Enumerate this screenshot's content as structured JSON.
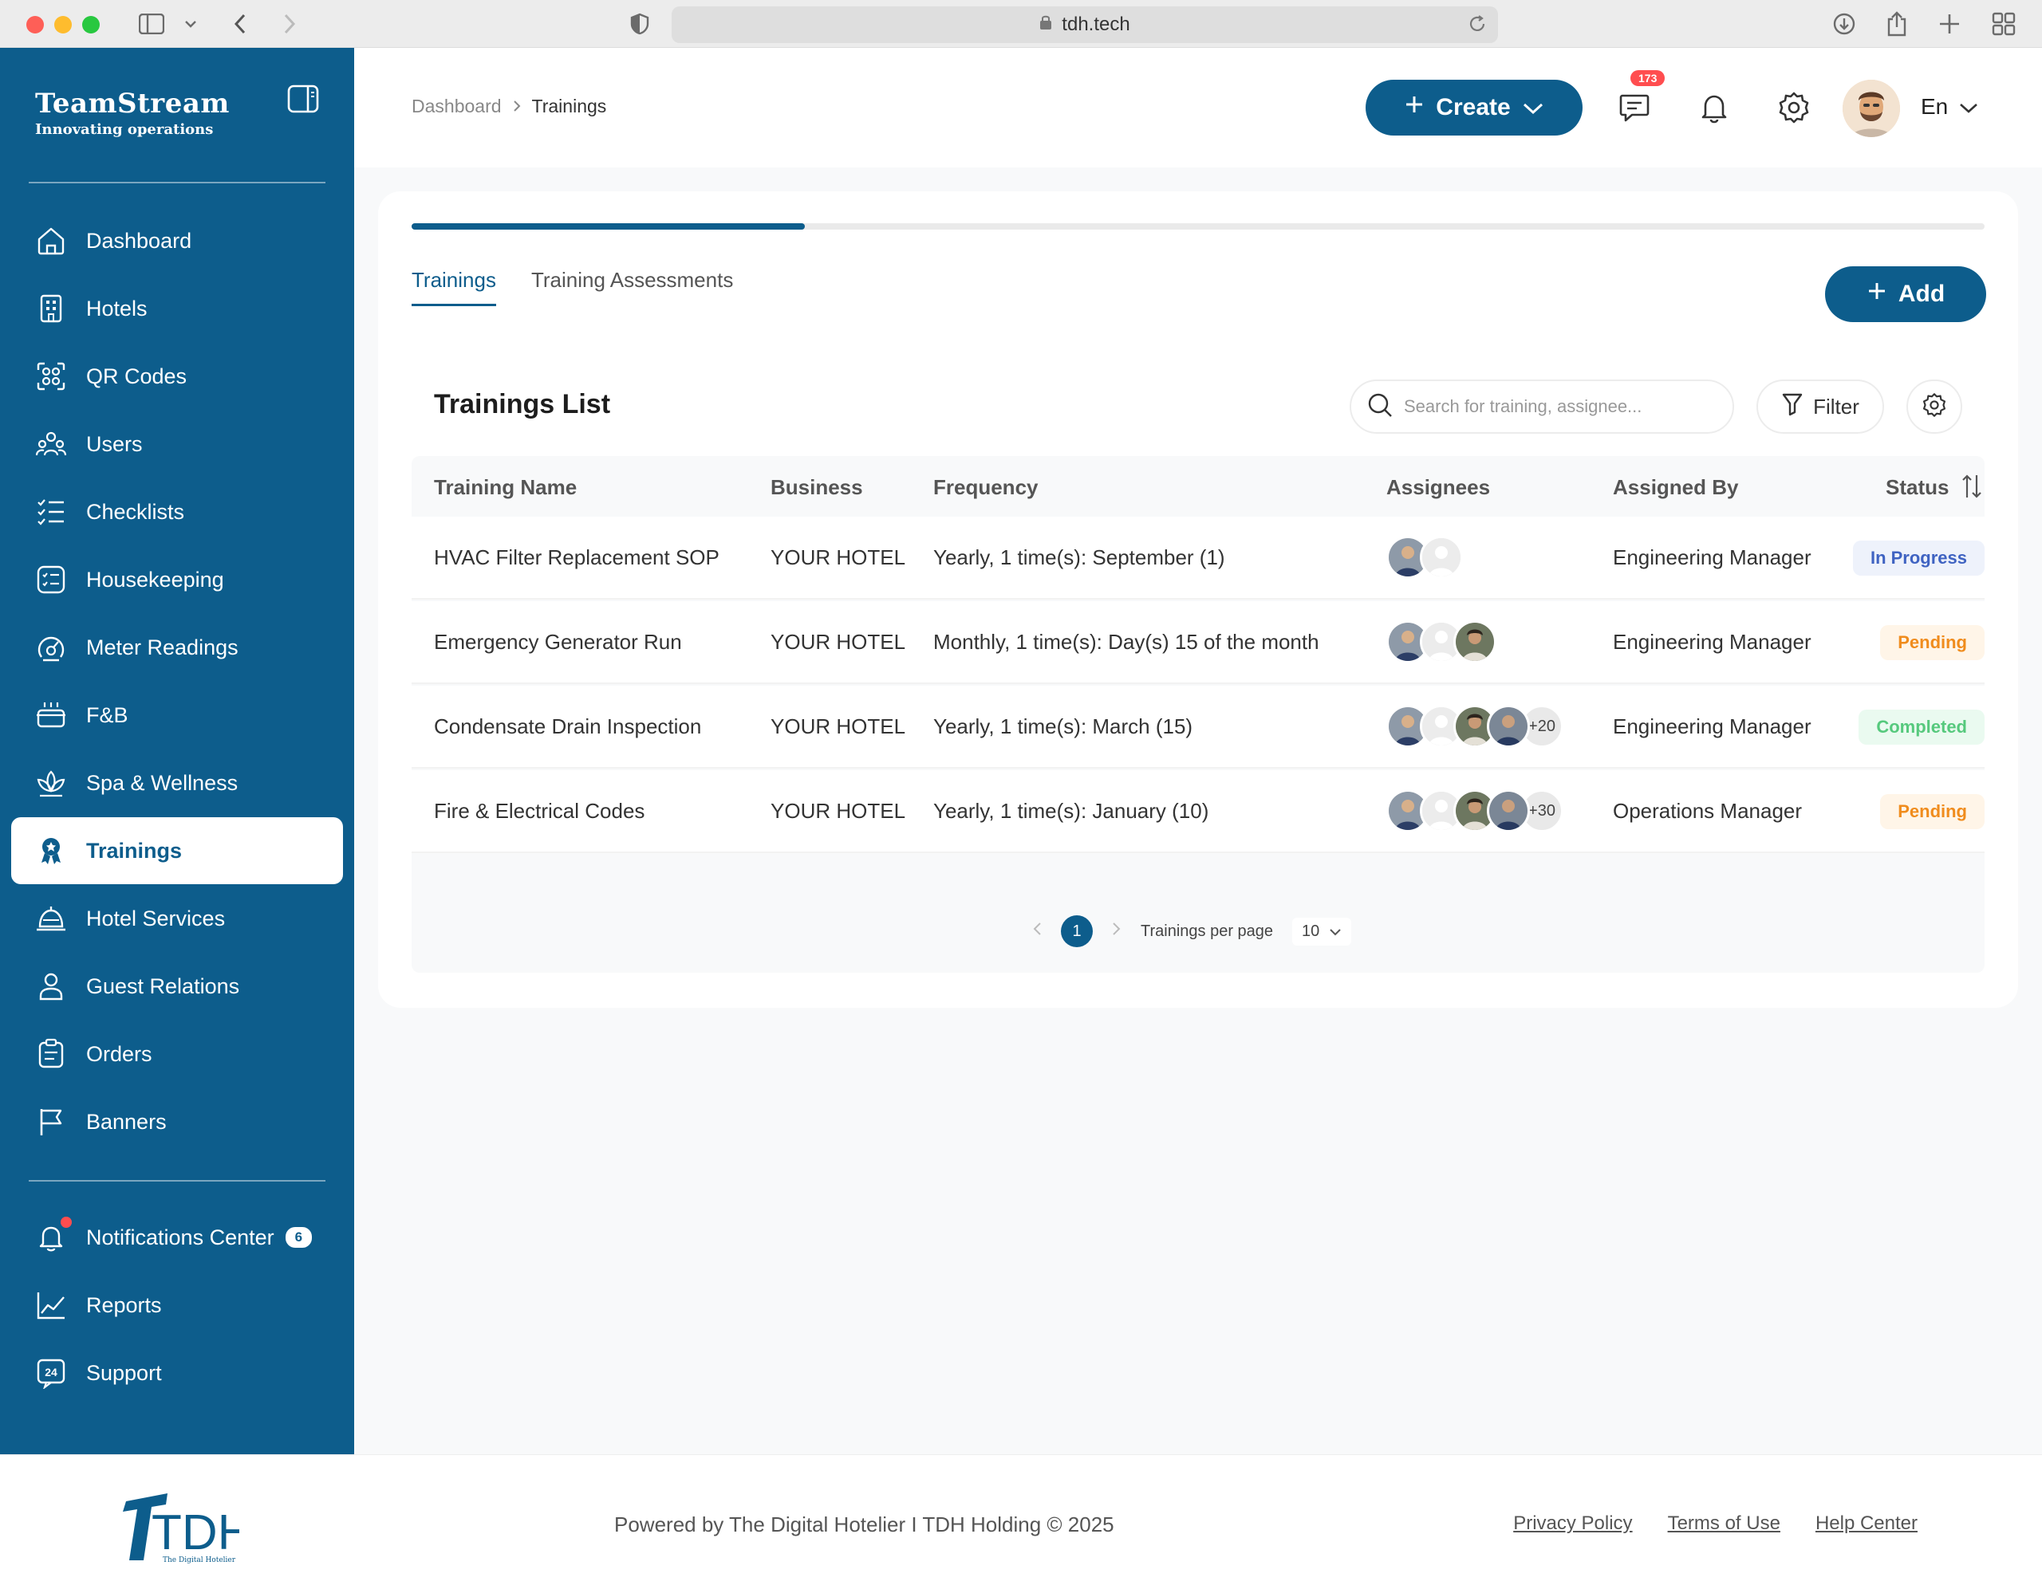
{
  "browser": {
    "url": "tdh.tech"
  },
  "brand": {
    "name": "TeamStream",
    "tagline": "Innovating operations"
  },
  "sidebar": {
    "items": [
      {
        "label": "Dashboard",
        "icon": "home-icon"
      },
      {
        "label": "Hotels",
        "icon": "building-icon"
      },
      {
        "label": "QR Codes",
        "icon": "qr-icon"
      },
      {
        "label": "Users",
        "icon": "users-icon"
      },
      {
        "label": "Checklists",
        "icon": "checklist-icon"
      },
      {
        "label": "Housekeeping",
        "icon": "housekeeping-icon"
      },
      {
        "label": "Meter Readings",
        "icon": "meter-icon"
      },
      {
        "label": "F&B",
        "icon": "food-icon"
      },
      {
        "label": "Spa & Wellness",
        "icon": "spa-icon"
      },
      {
        "label": "Trainings",
        "icon": "award-icon",
        "active": true
      },
      {
        "label": "Hotel Services",
        "icon": "bell-service-icon"
      },
      {
        "label": "Guest Relations",
        "icon": "person-icon"
      },
      {
        "label": "Orders",
        "icon": "clipboard-icon"
      },
      {
        "label": "Banners",
        "icon": "flag-icon"
      }
    ],
    "bottom_items": [
      {
        "label": "Notifications Center",
        "icon": "bell-icon",
        "badge": "6"
      },
      {
        "label": "Reports",
        "icon": "chart-icon"
      },
      {
        "label": "Support",
        "icon": "support-24-icon"
      }
    ]
  },
  "topbar": {
    "breadcrumb": {
      "root": "Dashboard",
      "current": "Trainings"
    },
    "create_label": "Create",
    "messages_badge": "173",
    "language": "En"
  },
  "main": {
    "progress_fraction": 0.25,
    "tabs": [
      {
        "label": "Trainings",
        "active": true
      },
      {
        "label": "Training Assessments",
        "active": false
      }
    ],
    "add_label": "Add",
    "list_title": "Trainings List",
    "search_placeholder": "Search for training, assignee...",
    "filter_label": "Filter",
    "columns": [
      "Training Name",
      "Business",
      "Frequency",
      "Assignees",
      "Assigned By",
      "Status"
    ],
    "rows": [
      {
        "name": "HVAC Filter Replacement SOP",
        "business": "YOUR HOTEL",
        "frequency": "Yearly, 1 time(s): September (1)",
        "assignees_shown": 2,
        "assignees_more": "",
        "assigned_by": "Engineering Manager",
        "status": "In Progress",
        "status_type": "progress"
      },
      {
        "name": "Emergency Generator Run",
        "business": "YOUR HOTEL",
        "frequency": "Monthly, 1 time(s): Day(s) 15 of the month",
        "assignees_shown": 3,
        "assignees_more": "",
        "assigned_by": "Engineering Manager",
        "status": "Pending",
        "status_type": "pending"
      },
      {
        "name": "Condensate Drain Inspection",
        "business": "YOUR HOTEL",
        "frequency": "Yearly, 1 time(s): March (15)",
        "assignees_shown": 4,
        "assignees_more": "+20",
        "assigned_by": "Engineering Manager",
        "status": "Completed",
        "status_type": "completed"
      },
      {
        "name": "Fire & Electrical Codes",
        "business": "YOUR HOTEL",
        "frequency": "Yearly, 1 time(s): January (10)",
        "assignees_shown": 4,
        "assignees_more": "+30",
        "assigned_by": "Operations Manager",
        "status": "Pending",
        "status_type": "pending"
      }
    ],
    "pagination": {
      "current_page": "1",
      "per_page_label": "Trainings per page",
      "per_page_value": "10"
    }
  },
  "footer": {
    "powered_by": "Powered by The Digital Hotelier I TDH Holding © 2025",
    "logo_text": "TDH",
    "logo_sub": "The Digital Hotelier",
    "links": [
      "Privacy Policy",
      "Terms of Use",
      "Help Center"
    ]
  },
  "colors": {
    "brand": "#0d5d8c",
    "progress": "#3f63c2",
    "pending": "#f08c1d",
    "completed": "#56c97d",
    "badge": "#ff4d4f"
  }
}
